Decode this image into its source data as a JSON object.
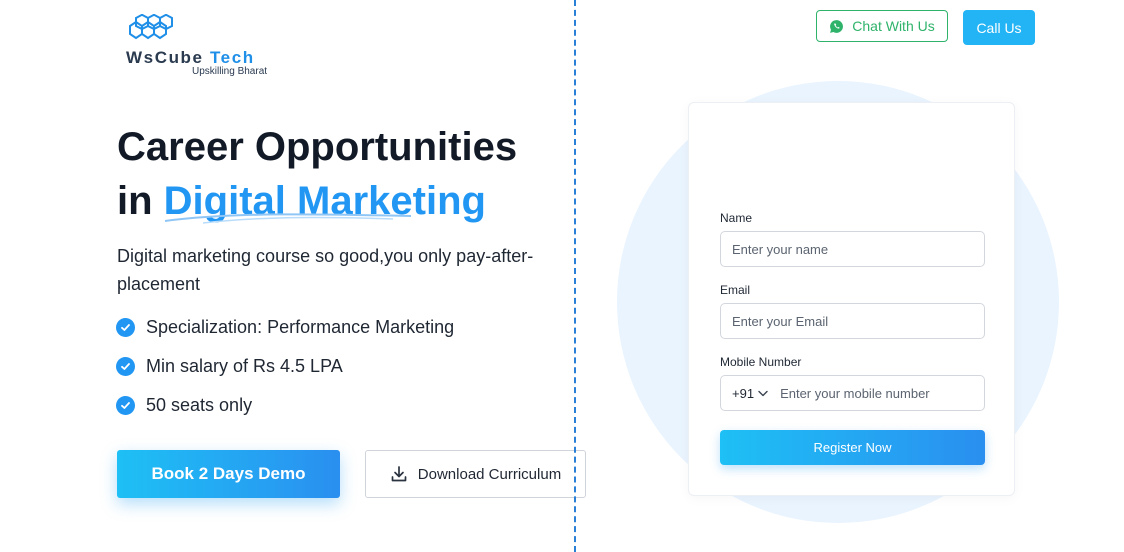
{
  "brand": {
    "name_part1": "WsCube",
    "name_part2": "Tech",
    "tagline": "Upskilling Bharat",
    "accent_color": "#2196f3"
  },
  "header": {
    "chat_label": "Chat With Us",
    "chat_icon": "whatsapp-icon",
    "call_label": "Call Us"
  },
  "hero": {
    "title_line1": "Career Opportunities",
    "title_line2_prefix": "in",
    "title_highlight": "Digital Marketing",
    "subtitle": "Digital marketing course so good,you only pay-after-placement",
    "features": [
      "Specialization: Performance Marketing",
      "Min salary of Rs 4.5 LPA",
      "50 seats only"
    ],
    "demo_button": "Book 2 Days Demo",
    "download_button": "Download Curriculum",
    "download_icon": "download-icon"
  },
  "form": {
    "name_label": "Name",
    "name_placeholder": "Enter your name",
    "email_label": "Email",
    "email_placeholder": "Enter your Email",
    "mobile_label": "Mobile Number",
    "country_code": "+91",
    "mobile_placeholder": "Enter your mobile number",
    "submit_label": "Register Now"
  }
}
